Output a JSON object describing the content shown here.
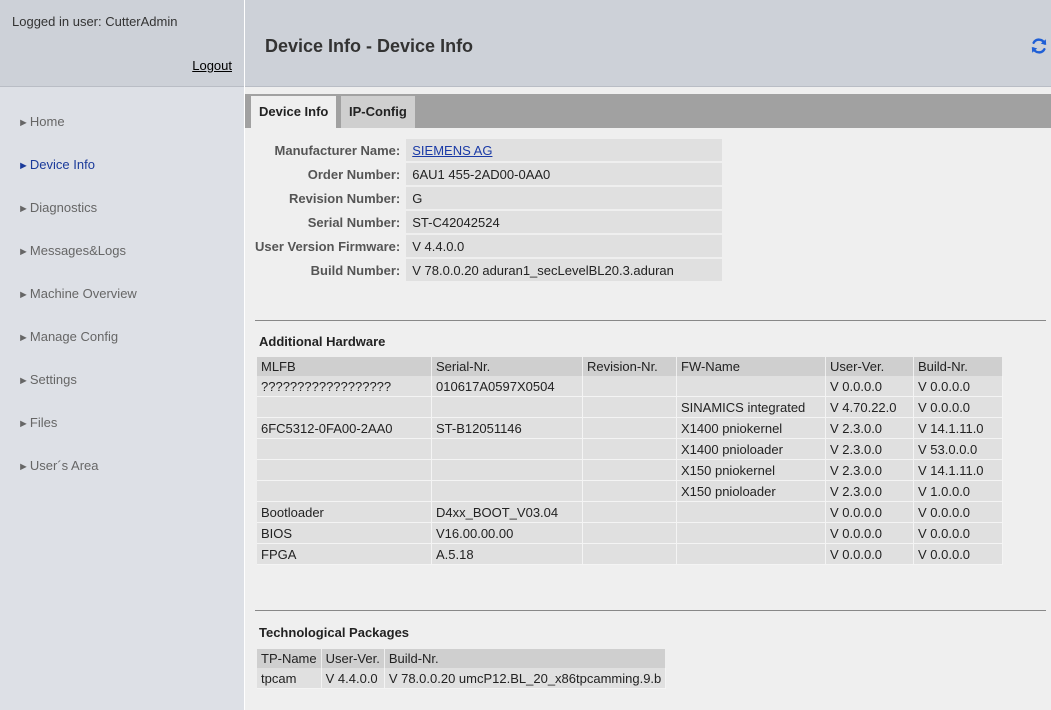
{
  "session": {
    "user_label": "Logged in user: CutterAdmin",
    "logout_label": "Logout"
  },
  "nav": [
    {
      "label": "Home",
      "active": false
    },
    {
      "label": "Device Info",
      "active": true
    },
    {
      "label": "Diagnostics",
      "active": false
    },
    {
      "label": "Messages&Logs",
      "active": false
    },
    {
      "label": "Machine Overview",
      "active": false
    },
    {
      "label": "Manage Config",
      "active": false
    },
    {
      "label": "Settings",
      "active": false
    },
    {
      "label": "Files",
      "active": false
    },
    {
      "label": "User´s Area",
      "active": false
    }
  ],
  "header": {
    "title": "Device Info - Device Info",
    "refresh_icon": "refresh-icon",
    "accent_color": "#1f5fd6"
  },
  "tabs": [
    {
      "label": "Device Info",
      "active": true
    },
    {
      "label": "IP-Config",
      "active": false
    }
  ],
  "device_info": {
    "manufacturer": {
      "label": "Manufacturer Name:",
      "value": "SIEMENS AG"
    },
    "order": {
      "label": "Order Number:",
      "value": "6AU1 455-2AD00-0AA0"
    },
    "revision": {
      "label": "Revision Number:",
      "value": "G"
    },
    "serial": {
      "label": "Serial Number:",
      "value": "ST-C42042524"
    },
    "firmware": {
      "label": "User Version Firmware:",
      "value": "V 4.4.0.0"
    },
    "build": {
      "label": "Build Number:",
      "value": "V 78.0.0.20 aduran1_secLevelBL20.3.aduran"
    }
  },
  "additional_hardware": {
    "title": "Additional Hardware",
    "headers": [
      "MLFB",
      "Serial-Nr.",
      "Revision-Nr.",
      "FW-Name",
      "User-Ver.",
      "Build-Nr."
    ],
    "rows": [
      [
        "??????????????????",
        "010617A0597X0504",
        "",
        "",
        "V 0.0.0.0",
        "V 0.0.0.0"
      ],
      [
        "",
        "",
        "",
        "SINAMICS integrated",
        "V 4.70.22.0",
        "V 0.0.0.0"
      ],
      [
        "6FC5312-0FA00-2AA0",
        "ST-B12051146",
        "",
        "X1400 pniokernel",
        "V 2.3.0.0",
        "V 14.1.11.0"
      ],
      [
        "",
        "",
        "",
        "X1400 pnioloader",
        "V 2.3.0.0",
        "V 53.0.0.0"
      ],
      [
        "",
        "",
        "",
        "X150 pniokernel",
        "V 2.3.0.0",
        "V 14.1.11.0"
      ],
      [
        "",
        "",
        "",
        "X150 pnioloader",
        "V 2.3.0.0",
        "V 1.0.0.0"
      ],
      [
        "Bootloader",
        "D4xx_BOOT_V03.04",
        "",
        "",
        "V 0.0.0.0",
        "V 0.0.0.0"
      ],
      [
        "BIOS",
        "V16.00.00.00",
        "",
        "",
        "V 0.0.0.0",
        "V 0.0.0.0"
      ],
      [
        "FPGA",
        "A.5.18",
        "",
        "",
        "V 0.0.0.0",
        "V 0.0.0.0"
      ]
    ]
  },
  "tech_packages": {
    "title": "Technological Packages",
    "headers": [
      "TP-Name",
      "User-Ver.",
      "Build-Nr."
    ],
    "rows": [
      [
        "tpcam",
        "V 4.4.0.0",
        "V 78.0.0.20 umcP12.BL_20_x86tpcamming.9.b"
      ]
    ]
  }
}
